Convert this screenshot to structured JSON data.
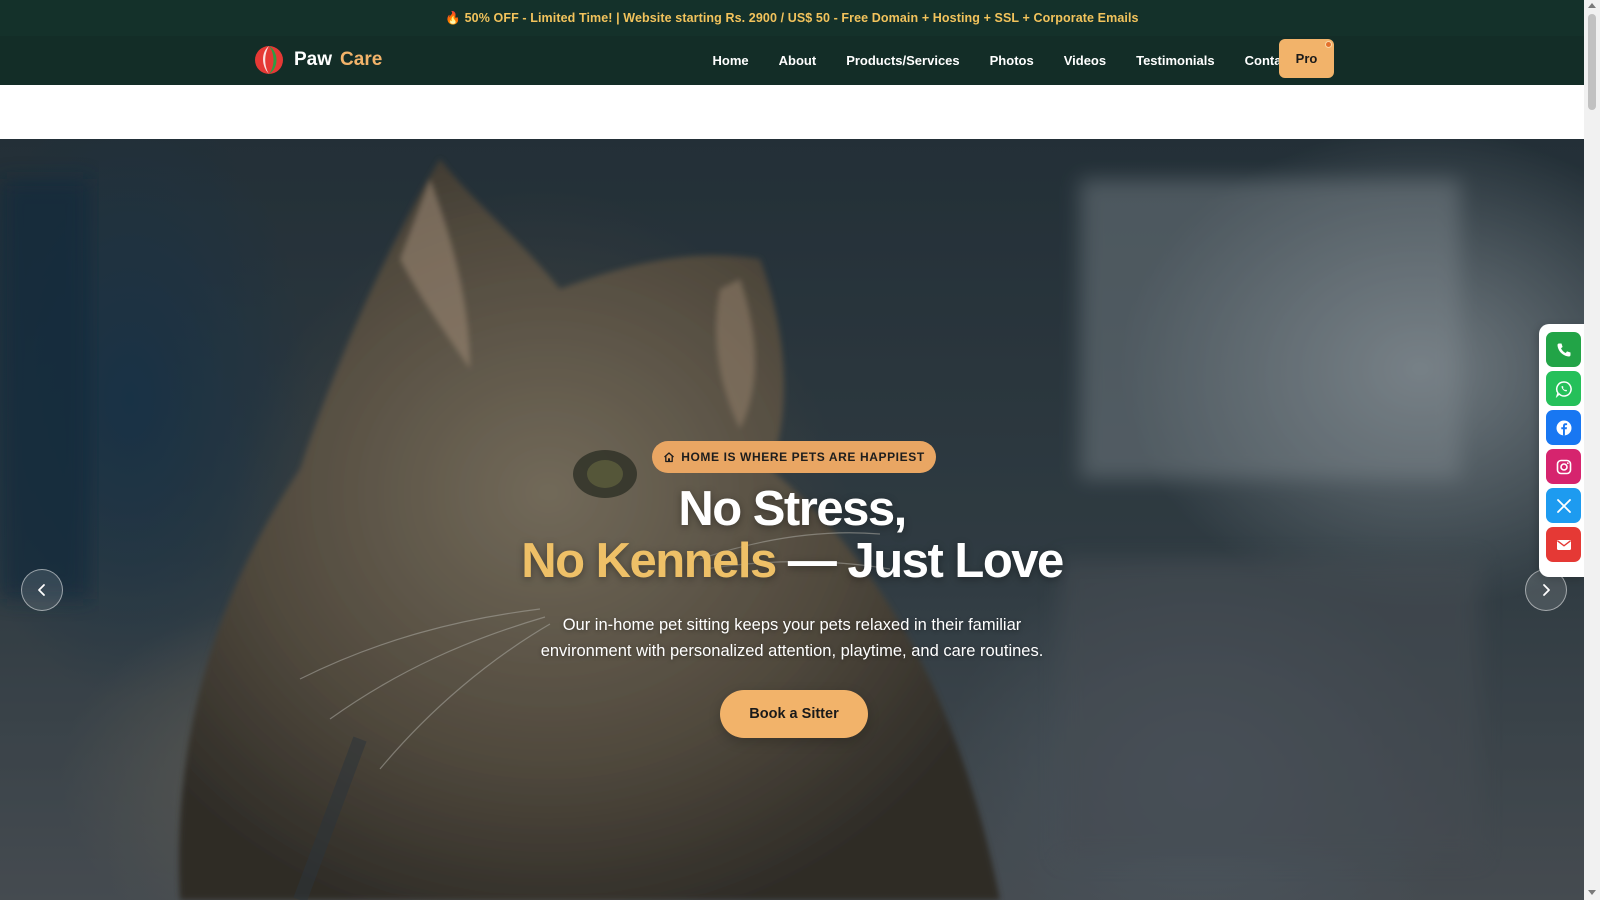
{
  "promo": {
    "text": "🔥 50% OFF - Limited Time! | Website starting Rs. 2900 / US$ 50 - Free Domain + Hosting + SSL + Corporate Emails"
  },
  "brand": {
    "word1": "Paw",
    "word2": "Care"
  },
  "nav": {
    "items": [
      {
        "label": "Home"
      },
      {
        "label": "About"
      },
      {
        "label": "Products/Services"
      },
      {
        "label": "Photos"
      },
      {
        "label": "Videos"
      },
      {
        "label": "Testimonials"
      },
      {
        "label": "Contact"
      }
    ],
    "pro_label": "Pro"
  },
  "hero": {
    "badge_icon": "home-icon",
    "badge": "HOME IS WHERE PETS ARE HAPPIEST",
    "headline_line1": "No Stress,",
    "headline_accent": "No Kennels",
    "headline_rest": " — Just Love",
    "subtext": "Our in-home pet sitting keeps your pets relaxed in their familiar environment with personalized attention, playtime, and care routines.",
    "cta": "Book a Sitter",
    "prev_icon": "chevron-left-icon",
    "next_icon": "chevron-right-icon"
  },
  "social": [
    {
      "icon": "phone-icon",
      "color": "#22a447"
    },
    {
      "icon": "whatsapp-icon",
      "color": "#25c05a"
    },
    {
      "icon": "facebook-icon",
      "color": "#1877f2"
    },
    {
      "icon": "instagram-icon",
      "color": "#d6246e"
    },
    {
      "icon": "x-icon",
      "color": "#1d9bf0"
    },
    {
      "icon": "mail-icon",
      "color": "#e53935"
    }
  ],
  "colors": {
    "accent": "#f2b36a",
    "headline_accent": "#eec067",
    "promo_bg": "#14312a",
    "nav_bg": "#132d27"
  }
}
